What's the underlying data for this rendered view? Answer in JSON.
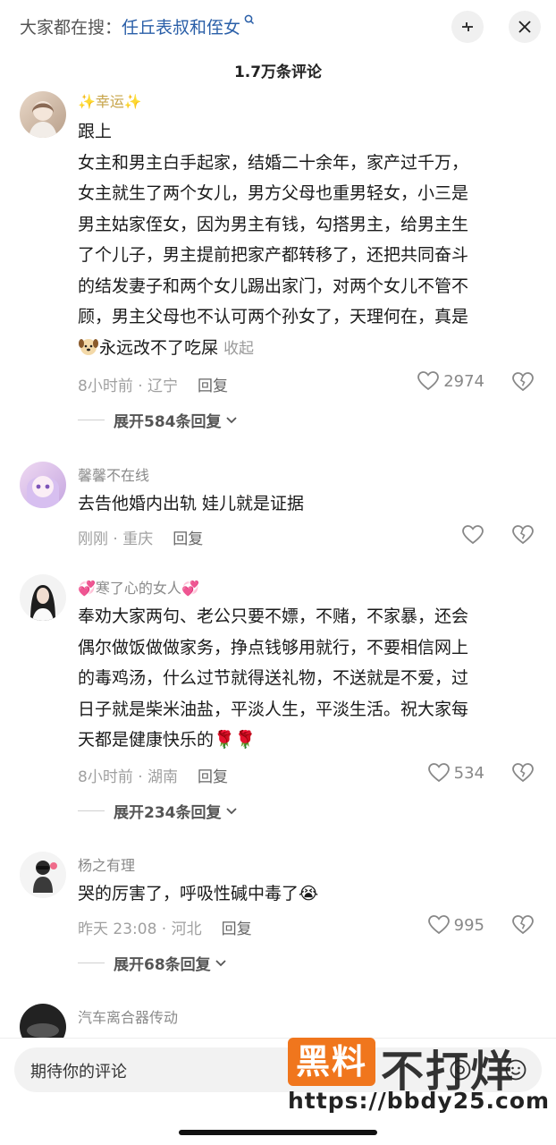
{
  "header": {
    "search_prefix": "大家都在搜：",
    "search_keyword": "任丘表叔和侄女",
    "comment_count": "1.7万条评论"
  },
  "comments": [
    {
      "username": "✨幸运✨",
      "lines": [
        "跟上",
        " 女主和男主白手起家，结婚二十余年，家产过千万，",
        "女主就生了两个女儿，男方父母也重男轻女，小三是",
        "男主姑家侄女，因为男主有钱，勾搭男主，给男主生",
        "了个儿子，男主提前把家产都转移了，还把共同奋斗",
        "的结发妻子和两个女儿踢出家门，对两个女儿不管不",
        "顾，男主父母也不认可两个孙女了，天理何在，真是"
      ],
      "last_line": "永远改不了吃屎",
      "fold_label": "收起",
      "meta": "8小时前 · 辽宁",
      "reply": "回复",
      "likes": "2974",
      "expand": "展开584条回复"
    },
    {
      "username": "馨馨不在线",
      "lines": [
        "去告他婚内出轨 娃儿就是证据"
      ],
      "meta": "刚刚 · 重庆",
      "reply": "回复",
      "likes": ""
    },
    {
      "username": "寒了心的女人",
      "lines": [
        "奉劝大家两句、老公只要不嫖，不赌，不家暴，还会",
        "偶尔做饭做做家务，挣点钱够用就行，不要相信网上",
        "的毒鸡汤，什么过节就得送礼物，不送就是不爱，过",
        "日子就是柴米油盐，平淡人生，平淡生活。祝大家每",
        "天都是健康快乐的🌹🌹"
      ],
      "meta": "8小时前 · 湖南",
      "reply": "回复",
      "likes": "534",
      "expand": "展开234条回复"
    },
    {
      "username": "杨之有理",
      "lines": [
        "哭的厉害了，呼吸性碱中毒了😭"
      ],
      "meta": "昨天 23:08 · 河北",
      "reply": "回复",
      "likes": "995",
      "expand": "展开68条回复"
    },
    {
      "username": "汽车离合器传动"
    }
  ],
  "composer": {
    "placeholder": "期待你的评论"
  },
  "watermark": {
    "box": "黑料",
    "text": "不打烊",
    "url": "https://bbdy25.com"
  },
  "icons": {
    "search_hint": "search-icon",
    "collapse": "collapse-icon",
    "close": "close-icon",
    "like": "heart-icon",
    "dislike": "broken-heart-icon",
    "expand": "chevron-down-icon",
    "at": "at-icon",
    "emoji": "smiley-icon"
  },
  "colors": {
    "keyword": "#2a5fa8",
    "watermark_box": "#f0761d",
    "rose": "#d6243a"
  }
}
